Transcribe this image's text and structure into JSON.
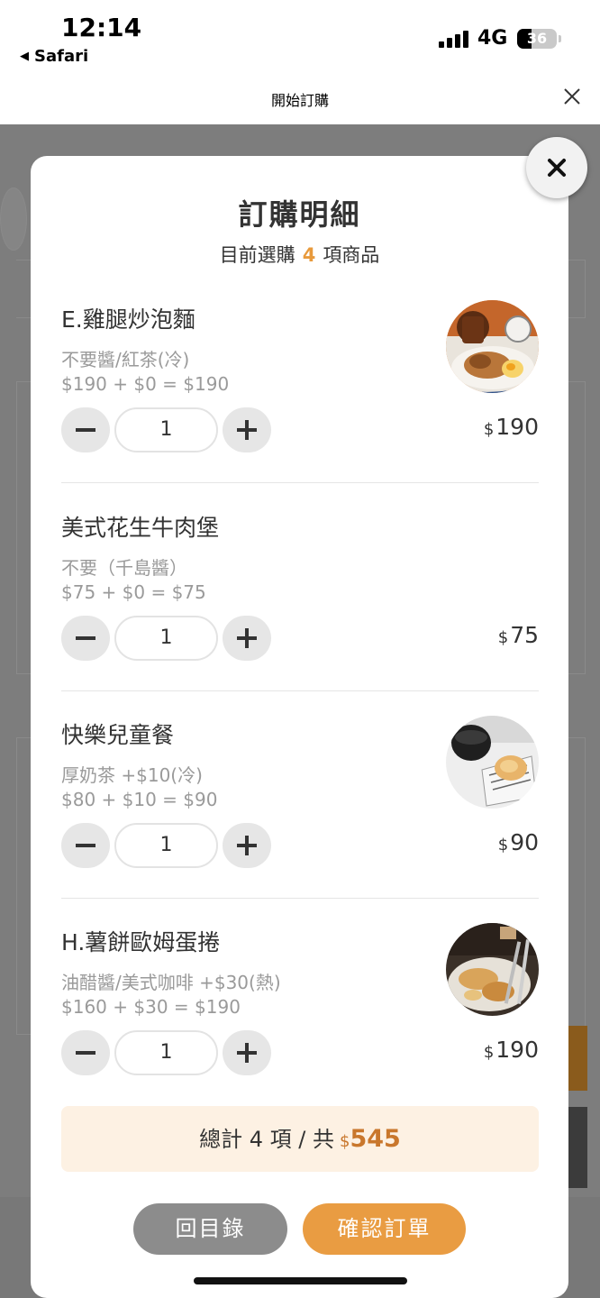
{
  "status_bar": {
    "time": "12:14",
    "back_app": "Safari",
    "network": "4G",
    "battery": "36"
  },
  "nav": {
    "title": "開始訂購"
  },
  "modal": {
    "title": "訂購明細",
    "subtitle_prefix": "目前選購",
    "subtitle_count": "4",
    "subtitle_suffix": "項商品",
    "currency": "$",
    "items": [
      {
        "name": "E.雞腿炒泡麵",
        "options": "不要醬/紅茶(冷)",
        "calc": "$190 + $0 = $190",
        "qty": "1",
        "price": "190",
        "has_image": true,
        "image": "chicken-noodle-plate-photo"
      },
      {
        "name": "美式花生牛肉堡",
        "options": "不要（千島醬）",
        "calc": "$75 + $0 = $75",
        "qty": "1",
        "price": "75",
        "has_image": false
      },
      {
        "name": "快樂兒童餐",
        "options": "厚奶茶 +$10(冷)",
        "calc": "$80 + $10 = $90",
        "qty": "1",
        "price": "90",
        "has_image": true,
        "image": "kids-meal-photo"
      },
      {
        "name": "H.薯餅歐姆蛋捲",
        "options": "油醋醬/美式咖啡 +$30(熱)",
        "calc": "$160 + $30 = $190",
        "qty": "1",
        "price": "190",
        "has_image": true,
        "image": "omelette-roll-photo"
      }
    ],
    "total": {
      "prefix": "總計 4 項 / 共",
      "currency": "$",
      "amount": "545"
    },
    "back_button": "回目錄",
    "confirm_button": "確認訂單"
  },
  "colors": {
    "accent": "#e89a3c",
    "total_bg": "#fdf1e3",
    "back_button_bg": "#8c8c8c",
    "overlay": "#7d7d7d"
  },
  "icons": {
    "close": "close-icon",
    "minus": "minus-icon",
    "plus": "plus-icon"
  }
}
